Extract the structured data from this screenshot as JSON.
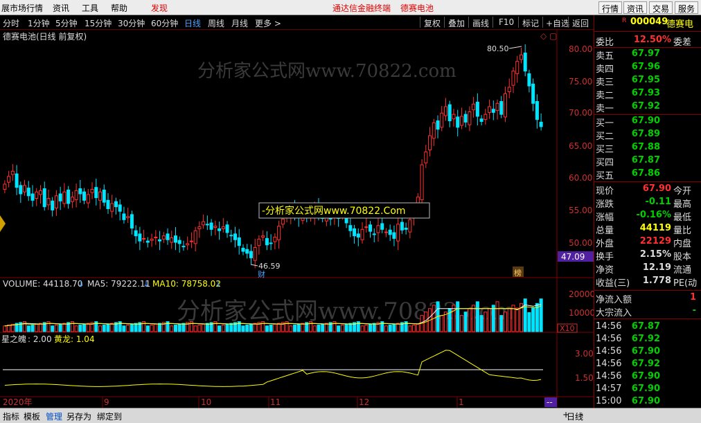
{
  "menubar": {
    "items": [
      "展市场行情",
      "资讯",
      "工具",
      "帮助",
      "发现"
    ],
    "center": [
      "通达信金融终端",
      "德赛电池"
    ],
    "right_buttons": [
      "行情",
      "资讯",
      "交易",
      "服务"
    ]
  },
  "toolbar": {
    "periods": [
      "分时",
      "1分钟",
      "5分钟",
      "15分钟",
      "30分钟",
      "60分钟",
      "日线",
      "周线",
      "月线",
      "更多 >"
    ],
    "active_period": "日线",
    "tools": [
      "复权",
      "叠加",
      "画线",
      "F10",
      "标记",
      "+自选",
      "返回"
    ]
  },
  "chart": {
    "title": "德赛电池(日线 前复权)",
    "watermark": "分析家公式网www.70822.com",
    "watermark_box": "-分析家公式网www.70822.Com",
    "price_axis": [
      "80.00",
      "75.00",
      "70.00",
      "65.00",
      "60.00",
      "55.00",
      "50.00"
    ],
    "current_price_tag": "47.09",
    "high_label": "80.50",
    "low_label": "46.59",
    "marker_cai": "财",
    "marker_bang": "榜",
    "volume_header": {
      "volume": "VOLUME: 44118.70",
      "ma5": "MA5: 79222.11",
      "ma10": "MA10: 78758.02"
    },
    "volume_axis": [
      "20000",
      "10000"
    ],
    "volume_unit": "X10",
    "indicator_header": {
      "name": "星之魄",
      "value": ": 2.00",
      "huanglong": "黄龙: 1.04"
    },
    "indicator_axis": [
      "3.00",
      "1.50"
    ],
    "date_axis": [
      "2020年",
      "9",
      "10",
      "11",
      "12",
      "1"
    ],
    "date_corner": "--"
  },
  "quote": {
    "code_badge": "R",
    "code": "000049",
    "name": "德赛电",
    "webi_label": "委比",
    "webi_value": "12.50%",
    "weicha_label": "委差",
    "asks": [
      {
        "label": "卖五",
        "price": "67.97"
      },
      {
        "label": "卖四",
        "price": "67.96"
      },
      {
        "label": "卖三",
        "price": "67.95"
      },
      {
        "label": "卖二",
        "price": "67.93"
      },
      {
        "label": "卖一",
        "price": "67.92"
      }
    ],
    "bids": [
      {
        "label": "买一",
        "price": "67.90"
      },
      {
        "label": "买二",
        "price": "67.89"
      },
      {
        "label": "买三",
        "price": "67.88"
      },
      {
        "label": "买四",
        "price": "67.87"
      },
      {
        "label": "买五",
        "price": "67.86"
      }
    ],
    "stats": [
      {
        "label": "现价",
        "value": "67.90",
        "extra": "今开",
        "color": "#ff3030"
      },
      {
        "label": "涨跌",
        "value": "-0.11",
        "extra": "最高",
        "color": "#00d000"
      },
      {
        "label": "涨幅",
        "value": "-0.16%",
        "extra": "最低",
        "color": "#00d000"
      },
      {
        "label": "总量",
        "value": "44119",
        "extra": "量比",
        "color": "#ffff00"
      },
      {
        "label": "外盘",
        "value": "22129",
        "extra": "内盘",
        "color": "#ff3030"
      },
      {
        "label": "换手",
        "value": "2.15%",
        "extra": "股本",
        "color": "#dddddd"
      },
      {
        "label": "净资",
        "value": "12.19",
        "extra": "流通",
        "color": "#dddddd"
      },
      {
        "label": "收益(三)",
        "value": "1.778",
        "extra": "PE(动",
        "color": "#dddddd"
      }
    ],
    "flow": [
      {
        "label": "净流入额",
        "value": "1",
        "color": "#ff3030"
      },
      {
        "label": "大宗流入",
        "value": "-",
        "color": "#00d000"
      }
    ],
    "ticks": [
      {
        "time": "14:56",
        "price": "67.87"
      },
      {
        "time": "14:56",
        "price": "67.92"
      },
      {
        "time": "14:56",
        "price": "67.90"
      },
      {
        "time": "14:56",
        "price": "67.92"
      },
      {
        "time": "14:56",
        "price": "67.90"
      },
      {
        "time": "14:57",
        "price": "67.90"
      },
      {
        "time": "15:00",
        "price": "67.90"
      }
    ]
  },
  "bottom": {
    "items": [
      "指标",
      "模板",
      "管理",
      "另存为",
      "绑定到"
    ],
    "active_item": "管理",
    "period_label": "日线",
    "controls": [
      "+",
      "-"
    ]
  },
  "colors": {
    "up": "#ff3030",
    "down": "#00e5ff",
    "grid": "#800000",
    "ma": "#ffffff",
    "ma_yellow": "#ffff00",
    "watermark": "#3a3a3a"
  }
}
